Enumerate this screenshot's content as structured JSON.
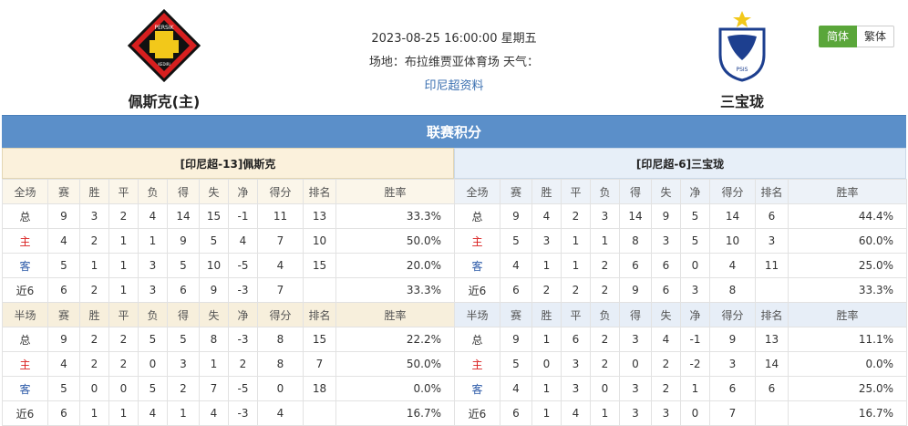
{
  "header": {
    "home": {
      "name": "佩斯克(主)",
      "logo_text": "PERSIK",
      "logo_sub": "KEDIRI"
    },
    "away": {
      "name": "三宝珑",
      "logo_text": "PSIS"
    },
    "datetime": "2023-08-25 16:00:00 星期五",
    "venue": "场地：布拉维贾亚体育场 天气：",
    "league_link": "印尼超资料",
    "lang_simplified": "简体",
    "lang_traditional": "繁体"
  },
  "section_title": "联赛积分",
  "colors": {
    "bar": "#5b8fc9",
    "home_red": "#d92020",
    "away_blue": "#2c5aa8",
    "active_green": "#5aa63a"
  },
  "left": {
    "title": "[印尼超-13]佩斯克",
    "full_headers": [
      "全场",
      "赛",
      "胜",
      "平",
      "负",
      "得",
      "失",
      "净",
      "得分",
      "排名",
      "胜率"
    ],
    "full_rows": [
      [
        "总",
        "9",
        "3",
        "2",
        "4",
        "14",
        "15",
        "-1",
        "11",
        "13",
        "33.3%"
      ],
      [
        "主",
        "4",
        "2",
        "1",
        "1",
        "9",
        "5",
        "4",
        "7",
        "10",
        "50.0%"
      ],
      [
        "客",
        "5",
        "1",
        "1",
        "3",
        "5",
        "10",
        "-5",
        "4",
        "15",
        "20.0%"
      ],
      [
        "近6",
        "6",
        "2",
        "1",
        "3",
        "6",
        "9",
        "-3",
        "7",
        "",
        "33.3%"
      ]
    ],
    "half_headers": [
      "半场",
      "赛",
      "胜",
      "平",
      "负",
      "得",
      "失",
      "净",
      "得分",
      "排名",
      "胜率"
    ],
    "half_rows": [
      [
        "总",
        "9",
        "2",
        "2",
        "5",
        "5",
        "8",
        "-3",
        "8",
        "15",
        "22.2%"
      ],
      [
        "主",
        "4",
        "2",
        "2",
        "0",
        "3",
        "1",
        "2",
        "8",
        "7",
        "50.0%"
      ],
      [
        "客",
        "5",
        "0",
        "0",
        "5",
        "2",
        "7",
        "-5",
        "0",
        "18",
        "0.0%"
      ],
      [
        "近6",
        "6",
        "1",
        "1",
        "4",
        "1",
        "4",
        "-3",
        "4",
        "",
        "16.7%"
      ]
    ]
  },
  "right": {
    "title": "[印尼超-6]三宝珑",
    "full_headers": [
      "全场",
      "赛",
      "胜",
      "平",
      "负",
      "得",
      "失",
      "净",
      "得分",
      "排名",
      "胜率"
    ],
    "full_rows": [
      [
        "总",
        "9",
        "4",
        "2",
        "3",
        "14",
        "9",
        "5",
        "14",
        "6",
        "44.4%"
      ],
      [
        "主",
        "5",
        "3",
        "1",
        "1",
        "8",
        "3",
        "5",
        "10",
        "3",
        "60.0%"
      ],
      [
        "客",
        "4",
        "1",
        "1",
        "2",
        "6",
        "6",
        "0",
        "4",
        "11",
        "25.0%"
      ],
      [
        "近6",
        "6",
        "2",
        "2",
        "2",
        "9",
        "6",
        "3",
        "8",
        "",
        "33.3%"
      ]
    ],
    "half_headers": [
      "半场",
      "赛",
      "胜",
      "平",
      "负",
      "得",
      "失",
      "净",
      "得分",
      "排名",
      "胜率"
    ],
    "half_rows": [
      [
        "总",
        "9",
        "1",
        "6",
        "2",
        "3",
        "4",
        "-1",
        "9",
        "13",
        "11.1%"
      ],
      [
        "主",
        "5",
        "0",
        "3",
        "2",
        "0",
        "2",
        "-2",
        "3",
        "14",
        "0.0%"
      ],
      [
        "客",
        "4",
        "1",
        "3",
        "0",
        "3",
        "2",
        "1",
        "6",
        "6",
        "25.0%"
      ],
      [
        "近6",
        "6",
        "1",
        "4",
        "1",
        "3",
        "3",
        "0",
        "7",
        "",
        "16.7%"
      ]
    ]
  }
}
